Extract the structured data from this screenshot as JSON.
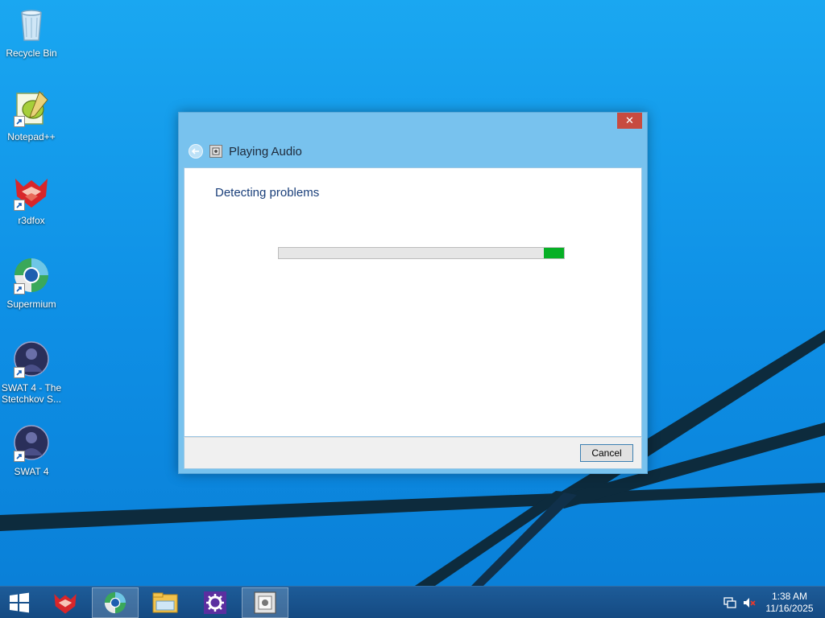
{
  "desktop": {
    "icons": [
      {
        "label": "Recycle Bin",
        "icon": "recycle-bin-icon"
      },
      {
        "label": "Notepad++",
        "icon": "notepad-plus-plus-icon"
      },
      {
        "label": "r3dfox",
        "icon": "r3dfox-icon"
      },
      {
        "label": "Supermium",
        "icon": "supermium-icon"
      },
      {
        "label": "SWAT 4 - The Stetchkov S...",
        "icon": "swat4-expansion-icon"
      },
      {
        "label": "SWAT 4",
        "icon": "swat4-icon"
      }
    ]
  },
  "dialog": {
    "title": "Playing Audio",
    "heading": "Detecting problems",
    "progress_fraction": 0.07,
    "close_label": "✕",
    "cancel_label": "Cancel"
  },
  "taskbar": {
    "apps": [
      {
        "name": "r3dfox",
        "icon": "r3dfox-icon",
        "active": false
      },
      {
        "name": "Supermium",
        "icon": "supermium-icon",
        "active": true
      },
      {
        "name": "File Explorer",
        "icon": "file-explorer-icon",
        "active": false
      },
      {
        "name": "Settings",
        "icon": "settings-icon",
        "active": false
      },
      {
        "name": "Playing Audio troubleshooter",
        "icon": "troubleshooter-icon",
        "active": true
      }
    ],
    "tray": {
      "network_icon": "network-icon",
      "volume_icon": "volume-muted-icon"
    },
    "clock": {
      "time": "1:38 AM",
      "date": "11/16/2025"
    }
  },
  "colors": {
    "desktop_blue": "#0f8fe6",
    "dialog_frame": "#78c2ee",
    "progress_green": "#06b025",
    "close_red": "#c74b40",
    "heading_blue": "#1a3f7a"
  }
}
